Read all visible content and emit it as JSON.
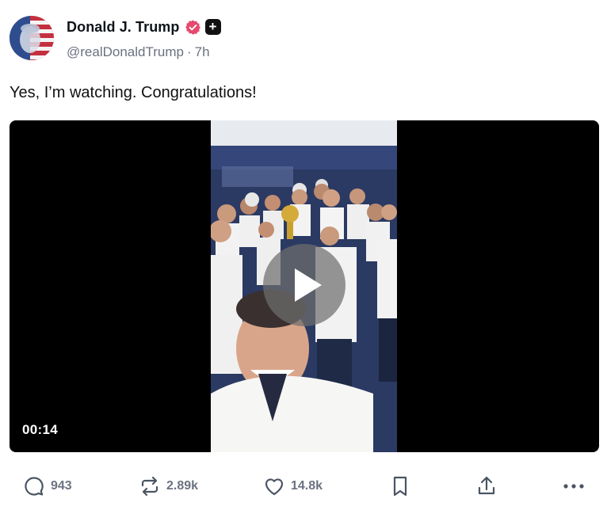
{
  "author": {
    "display_name": "Donald J. Trump",
    "handle": "@realDonaldTrump",
    "time_separator": "·",
    "time_ago": "7h",
    "verified_badge_color": "#e5496d"
  },
  "post": {
    "text": "Yes, I’m watching. Congratulations!"
  },
  "video": {
    "duration": "00:14",
    "play_icon": "play-icon"
  },
  "actions": {
    "reply_count": "943",
    "repost_count": "2.89k",
    "like_count": "14.8k",
    "icons": [
      "reply-icon",
      "repost-icon",
      "like-icon",
      "bookmark-icon",
      "share-icon",
      "more-icon"
    ]
  },
  "colors": {
    "text_primary": "#0f1419",
    "text_secondary": "#6b7280",
    "video_background": "#000000"
  }
}
